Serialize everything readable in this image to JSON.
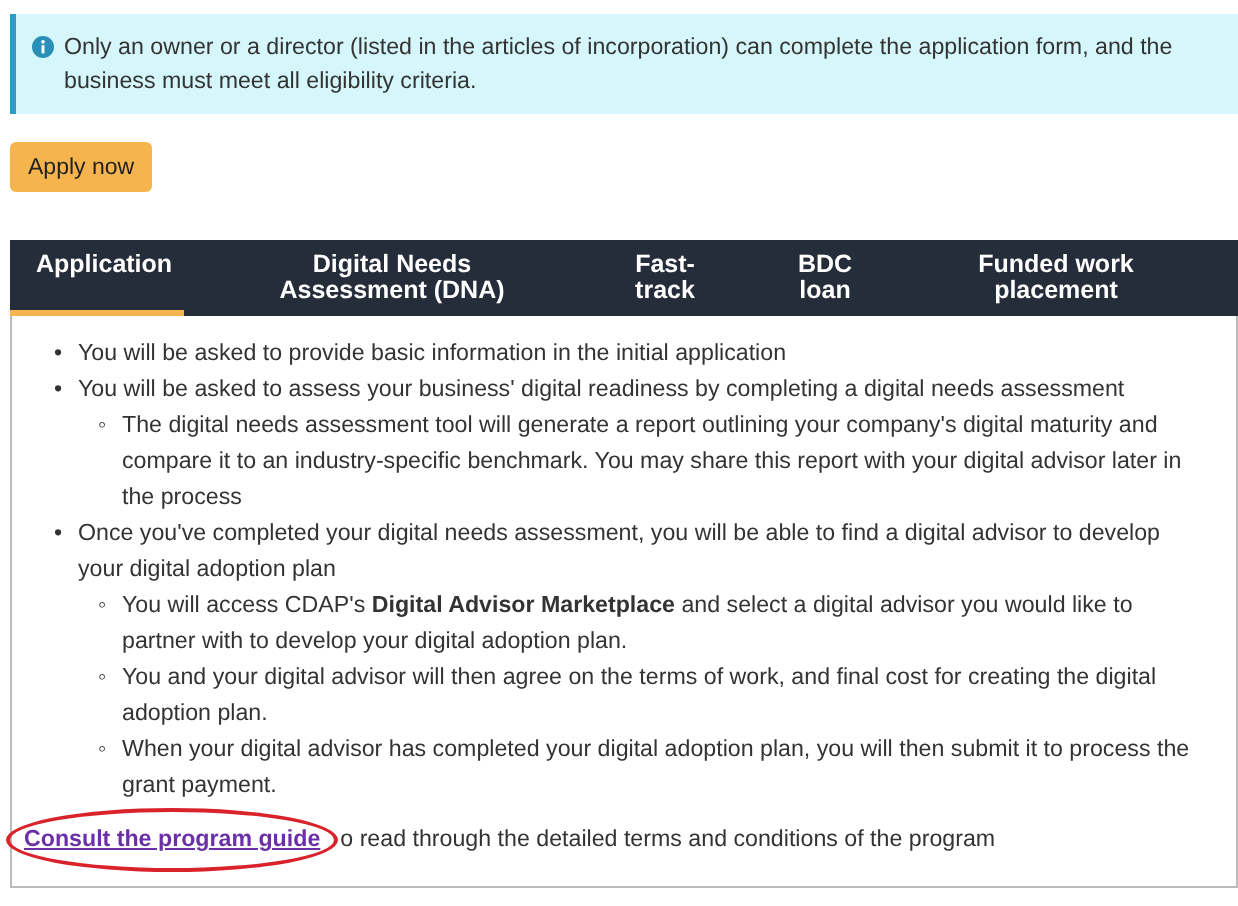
{
  "notice": {
    "text": "Only an owner or a director (listed in the articles of incorporation) can complete the application form, and the business must meet all eligibility criteria."
  },
  "apply_button": {
    "label": "Apply now"
  },
  "tabs": [
    {
      "label": "Application",
      "selected": true
    },
    {
      "label": "Digital Needs Assessment (DNA)",
      "selected": false
    },
    {
      "label": "Fast-track",
      "selected": false
    },
    {
      "label": "BDC loan",
      "selected": false
    },
    {
      "label": "Funded work placement",
      "selected": false
    }
  ],
  "steps": [
    {
      "marker": "•",
      "text": "You will be asked to provide basic information in the initial application"
    },
    {
      "marker": "•",
      "text": "You will be asked to assess your business' digital readiness by completing a digital needs assessment",
      "children": [
        {
          "marker": "◦",
          "text": "The digital needs assessment tool will generate a report outlining your company's digital maturity and compare it to an industry-specific benchmark. You may share this report with your digital advisor later in the process"
        }
      ]
    },
    {
      "marker": "•",
      "text": "Once you've completed your digital needs assessment, you will be able to find a digital advisor to develop your digital adoption plan",
      "children": [
        {
          "marker": "◦",
          "text": "You will access CDAP's **Digital Advisor Marketplace** and select a digital advisor you would like to partner with to develop your digital adoption plan."
        },
        {
          "marker": "◦",
          "text": "You and your digital advisor will then agree on the terms of work, and final cost for creating the digital adoption plan."
        },
        {
          "marker": "◦",
          "text": "When your digital advisor has completed your digital adoption plan, you will then submit it to process the grant payment."
        }
      ]
    }
  ],
  "guide": {
    "link": "Consult the program guide",
    "text": "o read through the detailed terms and conditions of the program",
    "highlighted": true
  }
}
